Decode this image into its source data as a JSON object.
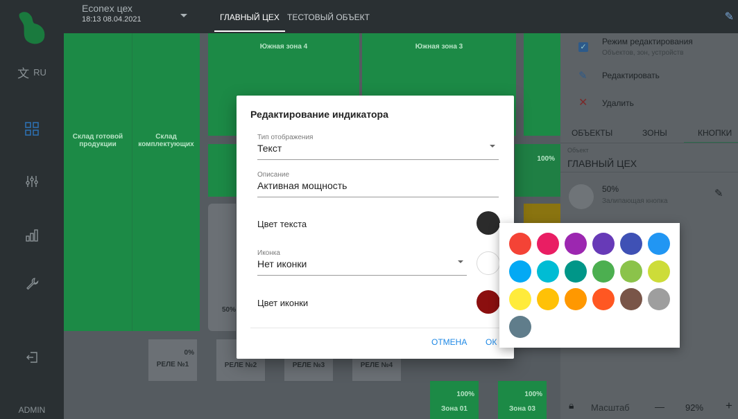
{
  "sidebar": {
    "lang_label": "RU",
    "user_label": "ADMIN",
    "icons": [
      "translate-icon",
      "dashboard-icon",
      "sliders-icon",
      "chart-icon",
      "wrench-icon",
      "logout-icon"
    ]
  },
  "topbar": {
    "company_name": "Econex цех",
    "datetime": "18:13 08.04.2021",
    "tabs": [
      "ГЛАВНЫЙ ЦЕХ",
      "ТЕСТОВЫЙ ОБЪЕКТ"
    ]
  },
  "canvas": {
    "zone_south4": "Южная зона 4",
    "zone_south3": "Южная зона 3",
    "warehouse1": "Склад готовой продукции",
    "warehouse2": "Склад комплектующих",
    "relays": [
      "РЕЛЕ №1",
      "РЕЛЕ №2",
      "РЕЛЕ №3",
      "РЕЛЕ №4"
    ],
    "relay1_value": "0%",
    "indicator_100": "100%",
    "indicator_50": "50%",
    "zone01_value": "100%",
    "zone01": "Зона 01",
    "zone03_value": "100%",
    "zone03": "Зона 03"
  },
  "right_panel": {
    "edit_mode_title": "Режим редактирования",
    "edit_mode_subtitle": "Объектов, зон, устройств",
    "edit_label": "Редактировать",
    "delete_label": "Удалить",
    "tabs": [
      "ОБЪЕКТЫ",
      "ЗОНЫ",
      "КНОПКИ"
    ],
    "object_label": "Объект",
    "object_value": "ГЛАВНЫЙ ЦЕХ",
    "button_value": "50%",
    "button_type": "Залипающая кнопка",
    "scale_label": "Масштаб",
    "scale_value": "92%",
    "minus": "—",
    "plus": "+"
  },
  "dialog": {
    "title": "Редактирование индикатора",
    "display_type_label": "Тип отображения",
    "display_type_value": "Текст",
    "description_label": "Описание",
    "description_value": "Активная мощность",
    "text_color_label": "Цвет текста",
    "icon_label": "Иконка",
    "icon_value": "Нет иконки",
    "icon_color_label": "Цвет иконки",
    "cancel_label": "ОТМЕНА",
    "ok_label": "ОК",
    "text_color": "#2b2b2b",
    "icon_color": "#8b0f0f"
  },
  "palette": {
    "colors": [
      "#f44336",
      "#e91e63",
      "#9c27b0",
      "#673ab7",
      "#3f51b5",
      "#2196f3",
      "#03a9f4",
      "#00bcd4",
      "#009688",
      "#4caf50",
      "#8bc34a",
      "#cddc39",
      "#ffeb3b",
      "#ffc107",
      "#ff9800",
      "#ff5722",
      "#795548",
      "#9e9e9e",
      "#607d8b"
    ]
  }
}
